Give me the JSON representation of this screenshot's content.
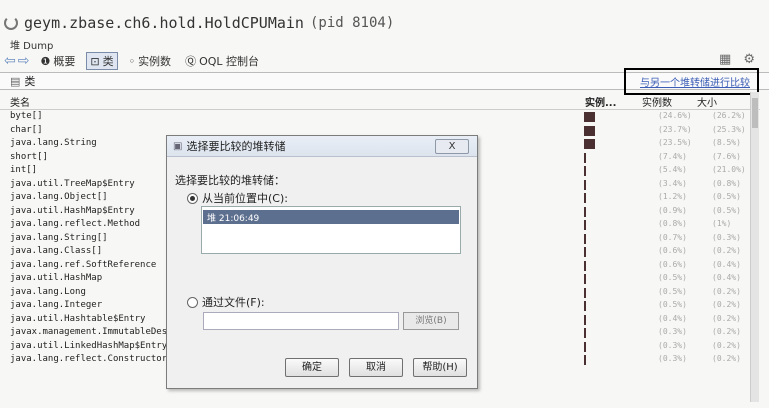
{
  "window": {
    "title": "geym.zbase.ch6.hold.HoldCPUMain",
    "pid": "(pid 8104)",
    "subtitle": "堆 Dump"
  },
  "toolbar": {
    "summary": "概要",
    "classes": "类",
    "instances": "实例数",
    "oql": "OQL 控制台"
  },
  "search": {
    "label": "类"
  },
  "compare_link": "与另一个堆转储进行比较",
  "columns": {
    "name": "类名",
    "instances": "实例...",
    "count": "实例数",
    "size": "大小"
  },
  "rows": [
    {
      "name": "byte[]",
      "bar": 0.95,
      "count": "(24.6%)",
      "size": "(26.2%)"
    },
    {
      "name": "char[]",
      "bar": 0.95,
      "count": "(23.7%)",
      "size": "(25.3%)"
    },
    {
      "name": "java.lang.String",
      "bar": 0.95,
      "count": "(23.5%)",
      "size": "(8.5%)"
    },
    {
      "name": "short[]",
      "bar": 0.2,
      "count": "(7.4%)",
      "size": "(7.6%)"
    },
    {
      "name": "int[]",
      "bar": 0.2,
      "count": "(5.4%)",
      "size": "(21.0%)"
    },
    {
      "name": "java.util.TreeMap$Entry",
      "bar": 0.1,
      "count": "(3.4%)",
      "size": "(0.8%)"
    },
    {
      "name": "java.lang.Object[]",
      "bar": 0.1,
      "count": "(1.2%)",
      "size": "(0.5%)"
    },
    {
      "name": "java.util.HashMap$Entry",
      "bar": 0.1,
      "count": "(0.9%)",
      "size": "(0.5%)"
    },
    {
      "name": "java.lang.reflect.Method",
      "bar": 0.1,
      "count": "(0.8%)",
      "size": "(1%)"
    },
    {
      "name": "java.lang.String[]",
      "bar": 0.1,
      "count": "(0.7%)",
      "size": "(0.3%)"
    },
    {
      "name": "java.lang.Class[]",
      "bar": 0.1,
      "count": "(0.6%)",
      "size": "(0.2%)"
    },
    {
      "name": "java.lang.ref.SoftReference",
      "bar": 0.1,
      "count": "(0.6%)",
      "size": "(0.4%)"
    },
    {
      "name": "java.util.HashMap",
      "bar": 0.1,
      "count": "(0.5%)",
      "size": "(0.4%)"
    },
    {
      "name": "java.lang.Long",
      "bar": 0.1,
      "count": "(0.5%)",
      "size": "(0.2%)"
    },
    {
      "name": "java.lang.Integer",
      "bar": 0.1,
      "count": "(0.5%)",
      "size": "(0.2%)"
    },
    {
      "name": "java.util.Hashtable$Entry",
      "bar": 0.1,
      "count": "(0.4%)",
      "size": "(0.2%)"
    },
    {
      "name": "javax.management.ImmutableDescr",
      "bar": 0.1,
      "count": "(0.3%)",
      "size": "(0.2%)"
    },
    {
      "name": "java.util.LinkedHashMap$Entry",
      "bar": 0.1,
      "count": "(0.3%)",
      "size": "(0.2%)"
    },
    {
      "name": "java.lang.reflect.Constructor",
      "bar": 0.1,
      "count": "(0.3%)",
      "size": "(0.2%)"
    }
  ],
  "dialog": {
    "title": "选择要比较的堆转储",
    "close": "X",
    "prompt": "选择要比较的堆转储：",
    "opt_current": "从当前位置中(C):",
    "list_item": "堆 21:06:49",
    "opt_file": "通过文件(F):",
    "browse": "浏览(B)",
    "ok": "确定",
    "cancel": "取消",
    "help": "帮助(H)"
  },
  "colors": {
    "bar": "#4a3030",
    "highlight": "#5d6f8f",
    "link": "#3b5db5"
  }
}
